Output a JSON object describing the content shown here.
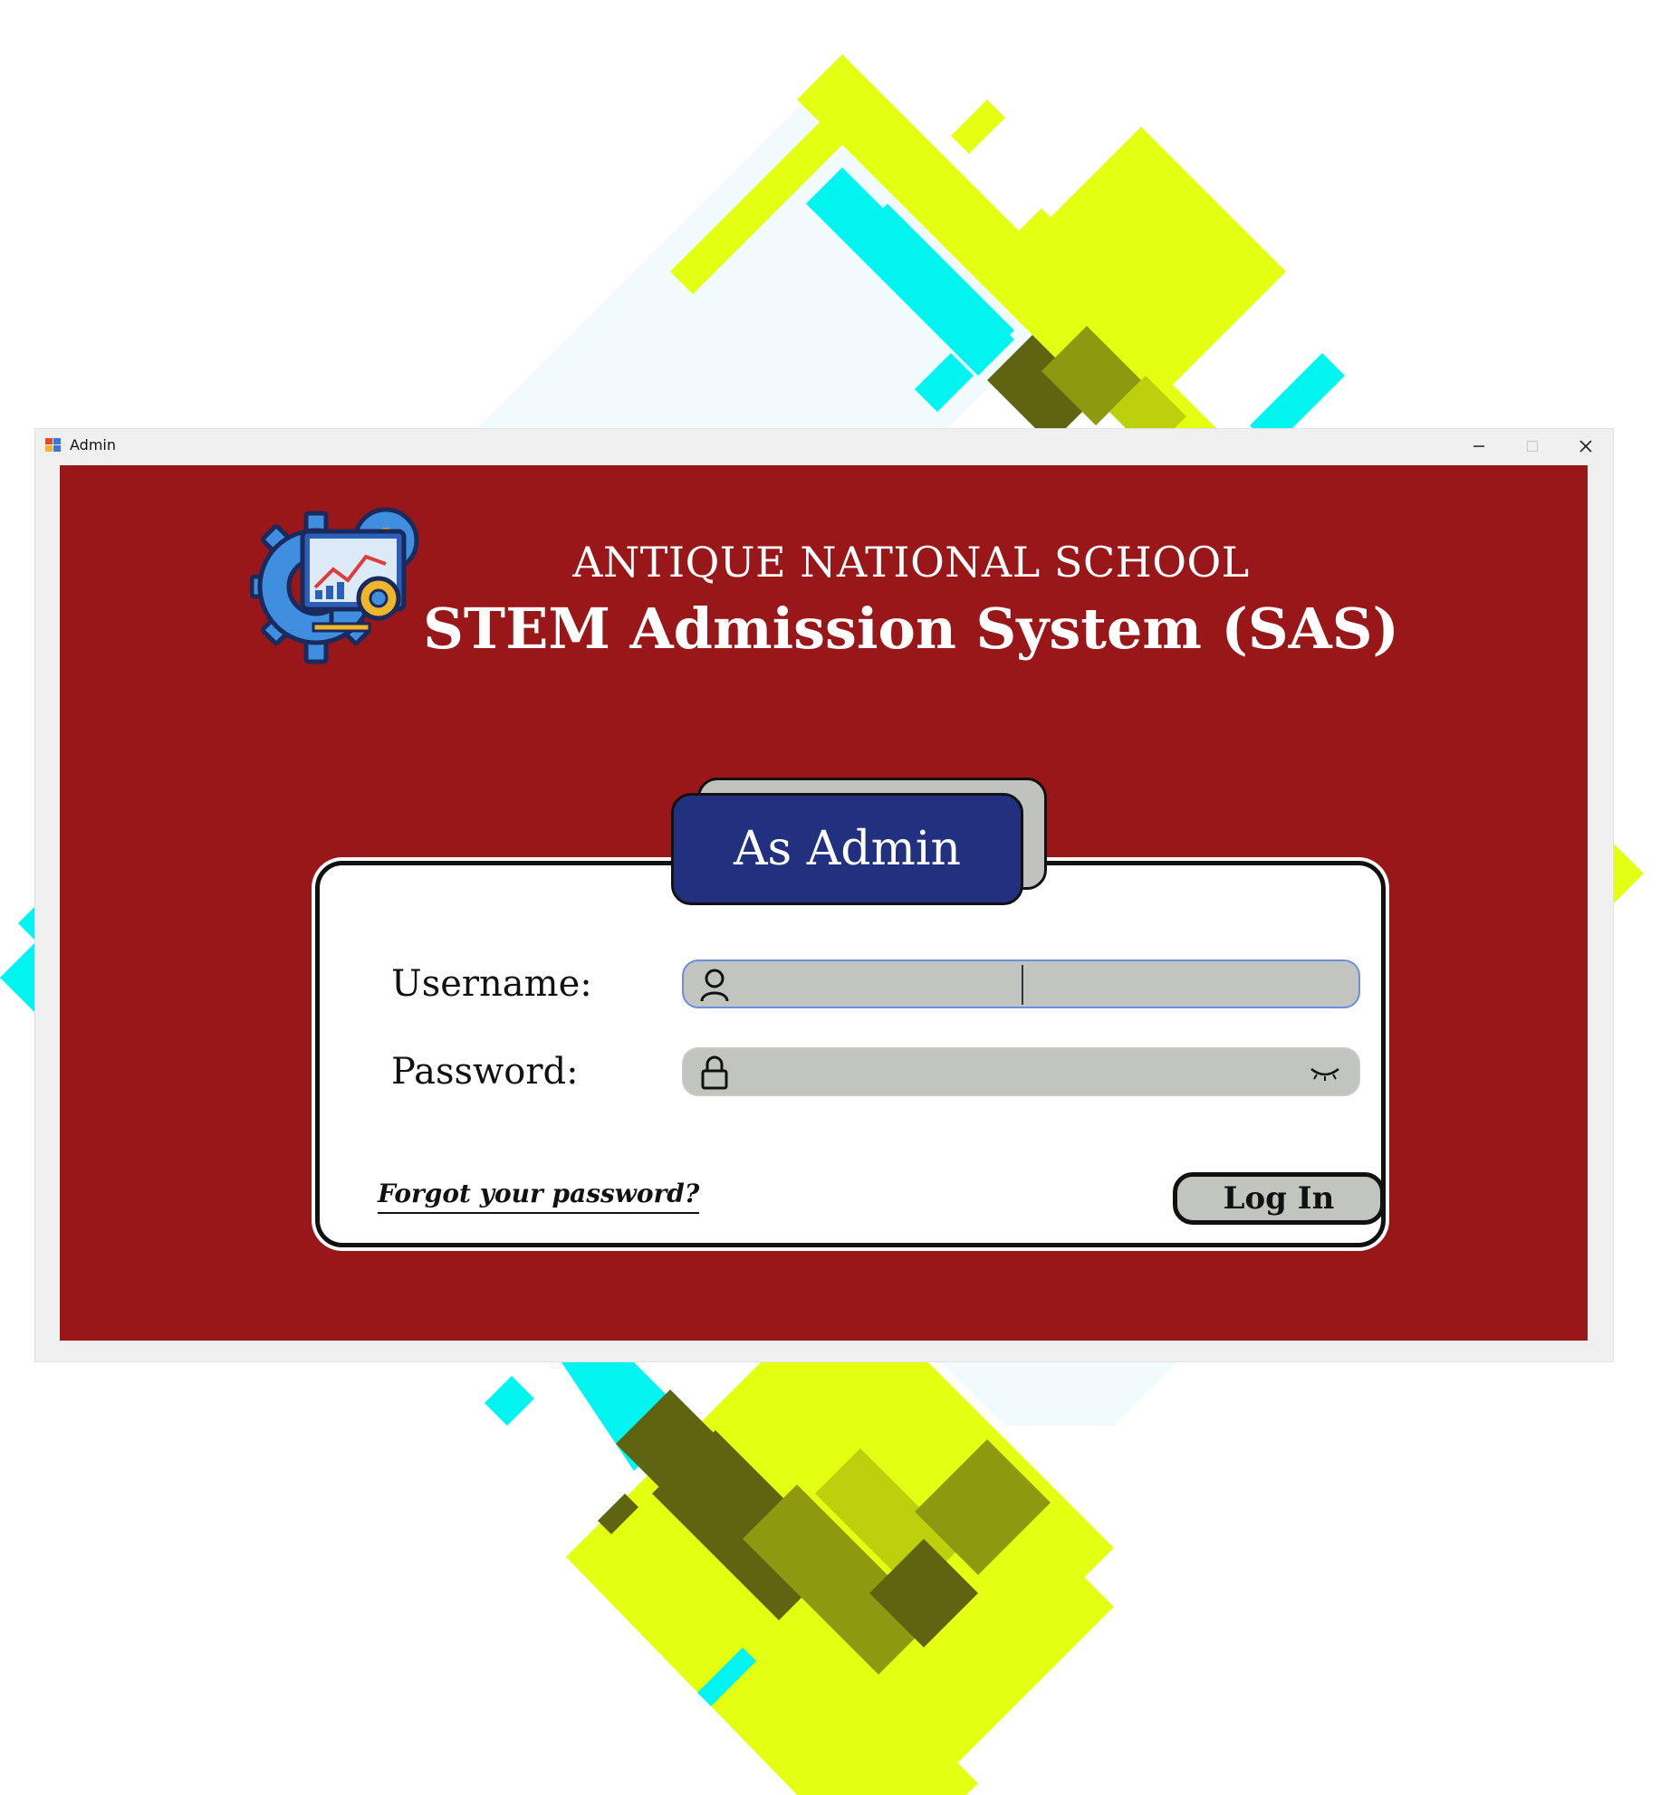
{
  "window": {
    "title": "Admin",
    "controls": [
      "minimize",
      "maximize",
      "close"
    ]
  },
  "header": {
    "school_name": "ANTIQUE NATIONAL SCHOOL",
    "system_name": "STEM Admission System (SAS)",
    "logo_icon": "gear-dashboard-icon"
  },
  "form": {
    "role_tab": "As Admin",
    "username_label": "Username:",
    "username_value": "",
    "password_label": "Password:",
    "password_value": "",
    "forgot_link": "Forgot your password?",
    "login_button": "Log In"
  },
  "icons": {
    "username": "user-icon",
    "password": "lock-icon",
    "reveal": "eye-closed-icon"
  },
  "colors": {
    "panel_background": "#9a1719",
    "tab_background": "#21317f",
    "field_background": "#c2c4bf",
    "decor_yellow": "#e3ff12",
    "decor_cyan": "#00f5f0"
  }
}
